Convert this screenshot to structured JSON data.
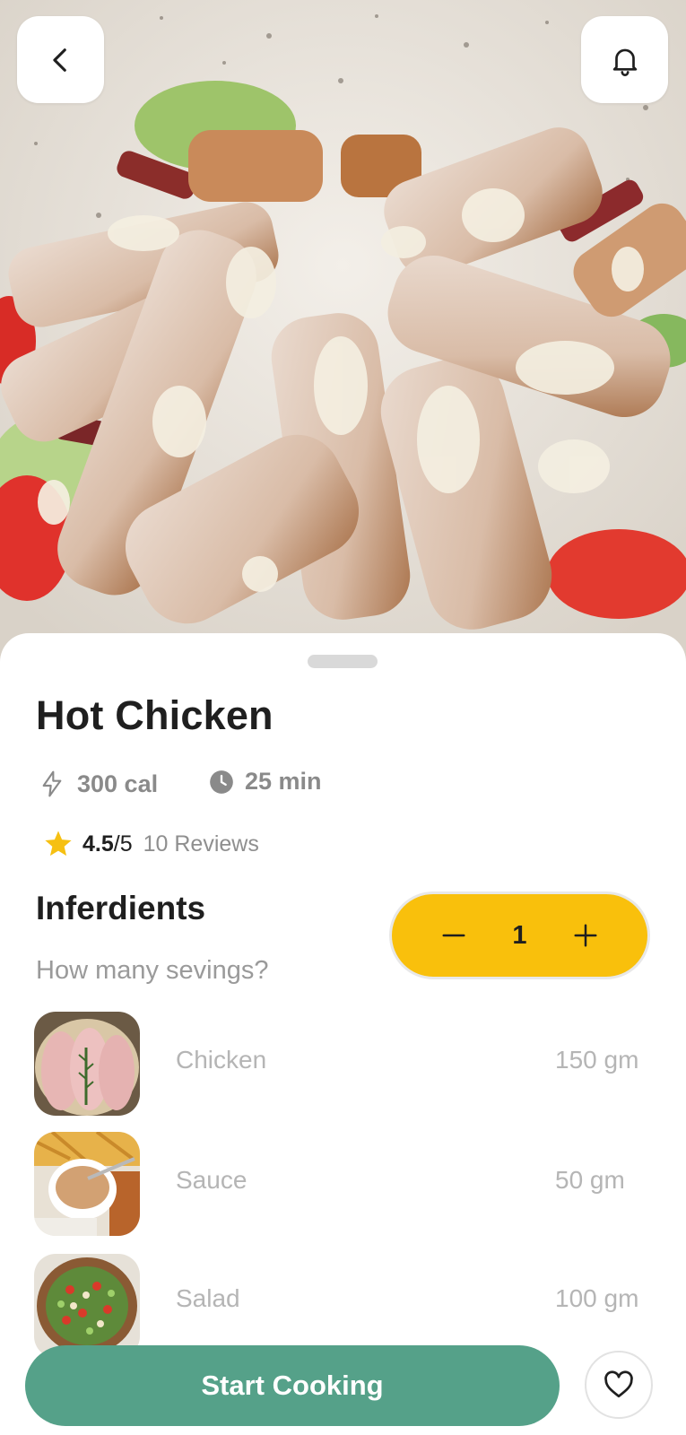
{
  "header": {
    "back_icon": "chevron-left-icon",
    "notification_icon": "bell-icon"
  },
  "recipe": {
    "title": "Hot Chicken",
    "calories": "300 cal",
    "time": "25 min",
    "rating_score": "4.5",
    "rating_outof": "/5",
    "reviews": "10 Reviews"
  },
  "ingredients_section": {
    "title": "Inferdients",
    "servings_question": "How many sevings?",
    "servings_value": "1",
    "items": [
      {
        "name": "Chicken",
        "quantity": "150 gm"
      },
      {
        "name": "Sauce",
        "quantity": "50 gm"
      },
      {
        "name": "Salad",
        "quantity": "100 gm"
      }
    ]
  },
  "actions": {
    "start_label": "Start Cooking",
    "favorite_icon": "heart-icon"
  },
  "colors": {
    "accent_yellow": "#f9c00c",
    "primary_green": "#55a189",
    "star": "#f6c012"
  }
}
